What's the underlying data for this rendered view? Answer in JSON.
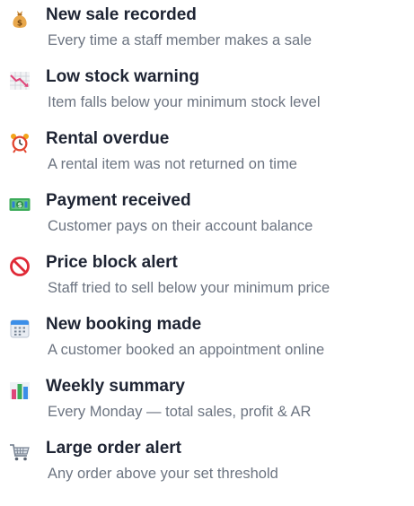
{
  "notifications": [
    {
      "icon": "money-bag-icon",
      "title": "New sale recorded",
      "description": "Every time a staff member makes a sale"
    },
    {
      "icon": "chart-decreasing-icon",
      "title": "Low stock warning",
      "description": "Item falls below your minimum stock level"
    },
    {
      "icon": "alarm-clock-icon",
      "title": "Rental overdue",
      "description": "A rental item was not returned on time"
    },
    {
      "icon": "dollar-banknote-icon",
      "title": "Payment received",
      "description": "Customer pays on their account balance"
    },
    {
      "icon": "prohibited-icon",
      "title": "Price block alert",
      "description": "Staff tried to sell below your minimum price"
    },
    {
      "icon": "calendar-icon",
      "title": "New booking made",
      "description": "A customer booked an appointment online"
    },
    {
      "icon": "bar-chart-icon",
      "title": "Weekly summary",
      "description": "Every Monday — total sales, profit & AR"
    },
    {
      "icon": "shopping-cart-icon",
      "title": "Large order alert",
      "description": "Any order above your set threshold"
    }
  ]
}
